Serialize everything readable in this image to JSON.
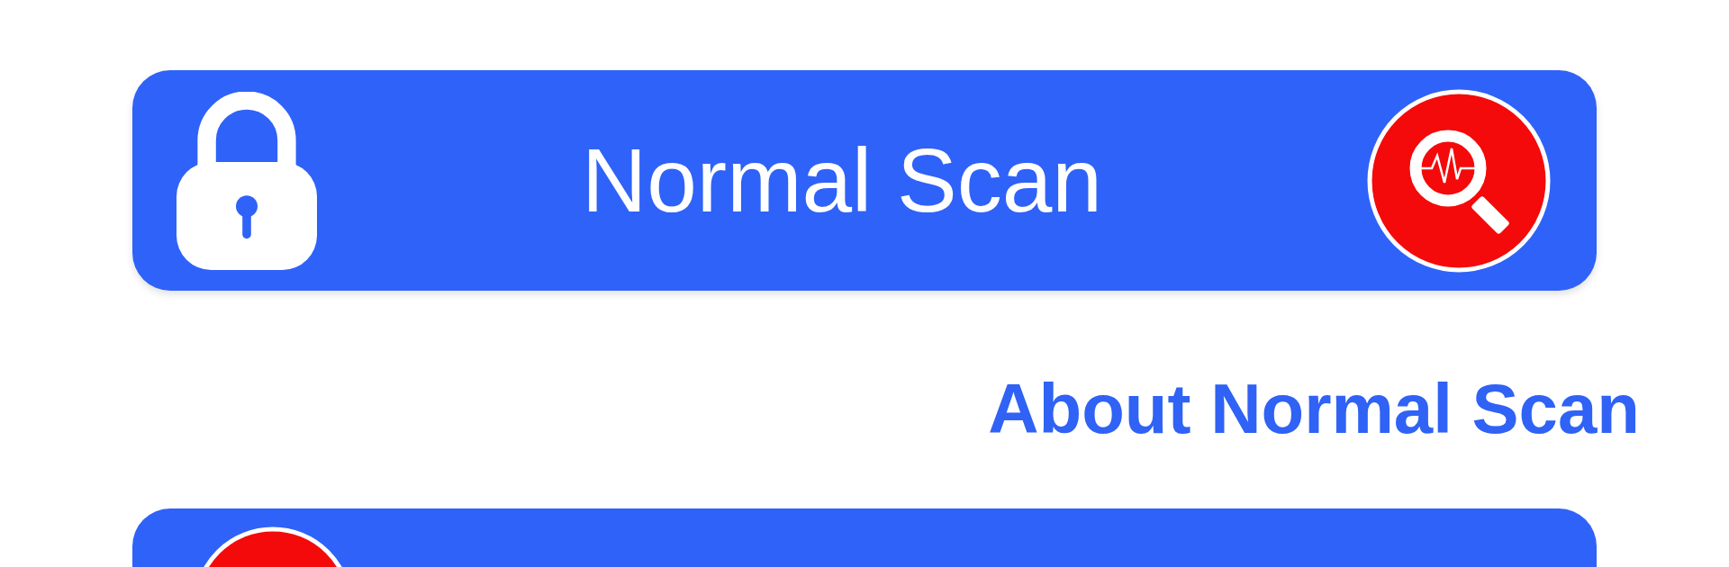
{
  "scan_button": {
    "label": "Normal Scan"
  },
  "about_link": {
    "label": "About Normal Scan"
  }
}
